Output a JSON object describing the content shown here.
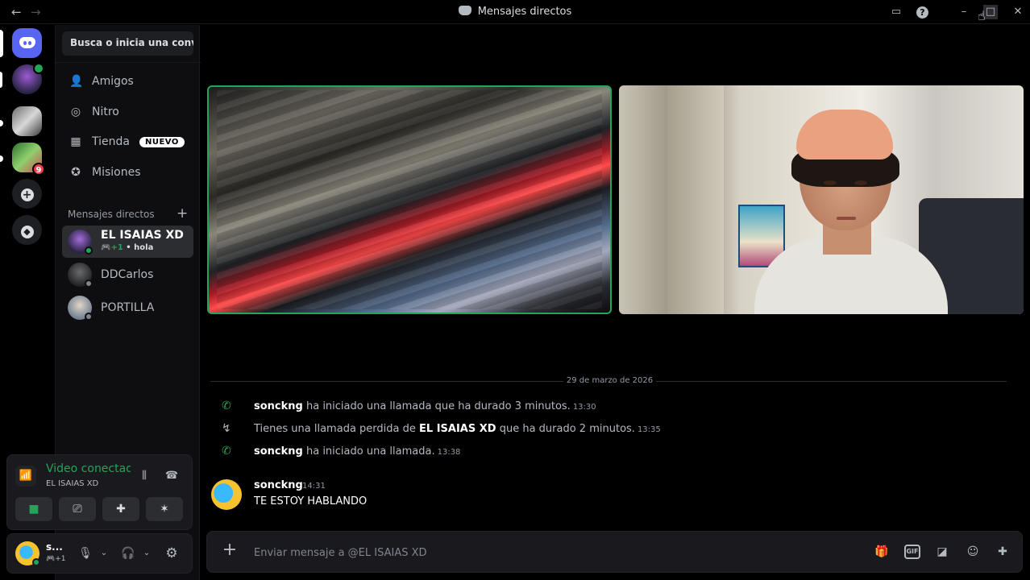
{
  "window": {
    "title": "Mensajes directos"
  },
  "sidebar": {
    "search_placeholder": "Busca o inicia una conv...",
    "nav": [
      {
        "label": "Amigos",
        "icon": "friends-icon"
      },
      {
        "label": "Nitro",
        "icon": "nitro-icon"
      },
      {
        "label": "Tienda",
        "icon": "shop-icon",
        "badge": "NUEVO"
      },
      {
        "label": "Misiones",
        "icon": "quests-icon"
      }
    ],
    "dm_header": "Mensajes directos",
    "dms": [
      {
        "name": "EL ISAIAS XD",
        "sub_icon": "+1",
        "sub_text": "hola",
        "active": true
      },
      {
        "name": "DDCarlos",
        "active": false
      },
      {
        "name": "PORTILLA",
        "active": false
      }
    ]
  },
  "servers": {
    "unread_badge": "9"
  },
  "voice": {
    "status": "Video conectado",
    "channel": "EL ISAIAS XD"
  },
  "user": {
    "name": "s...",
    "sub": "+1"
  },
  "chat": {
    "date": "29 de marzo de 2026",
    "system": [
      {
        "type": "call",
        "actor": "sonckng",
        "text": " ha iniciado una llamada que ha durado 3 minutos.",
        "time": "13:30"
      },
      {
        "type": "missed",
        "prefix": "Tienes una llamada perdida de ",
        "actor": "EL ISAIAS XD",
        "text": " que ha durado 2 minutos.",
        "time": "13:35"
      },
      {
        "type": "call",
        "actor": "sonckng",
        "text": " ha iniciado una llamada.",
        "time": "13:38"
      }
    ],
    "message": {
      "author": "sonckng",
      "time": "14:31",
      "text": "TE ESTOY HABLANDO"
    }
  },
  "composer": {
    "placeholder": "Enviar mensaje a @EL ISAIAS XD",
    "gif_label": "GIF"
  },
  "colors": {
    "accent": "#5865f2",
    "online": "#23a559",
    "badge": "#f23f43"
  }
}
